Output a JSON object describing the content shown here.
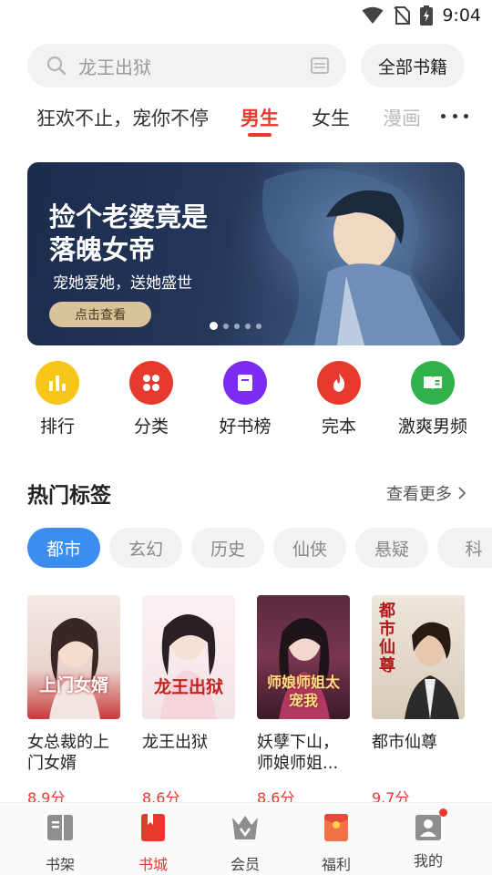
{
  "status_bar": {
    "time": "9:04"
  },
  "search": {
    "placeholder": "龙王出狱",
    "all_books_label": "全部书籍"
  },
  "tabs": [
    {
      "label": "狂欢不止，宠你不停"
    },
    {
      "label": "男生",
      "active": true
    },
    {
      "label": "女生"
    },
    {
      "label": "漫画"
    }
  ],
  "banner": {
    "title": "捡个老婆竟是\n落魄女帝",
    "subtitle": "宠她爱她，送她盛世",
    "button_label": "点击查看",
    "page_count": 5,
    "active_page": 0
  },
  "quick_entries": [
    {
      "label": "排行",
      "color": "#f5c518",
      "icon": "bar-chart-icon"
    },
    {
      "label": "分类",
      "color": "#e8392f",
      "icon": "grid-icon"
    },
    {
      "label": "好书榜",
      "color": "#7b2cf0",
      "icon": "booklist-icon"
    },
    {
      "label": "完本",
      "color": "#e8392f",
      "icon": "flame-icon"
    },
    {
      "label": "激爽男频",
      "color": "#2fb24a",
      "icon": "open-book-icon"
    }
  ],
  "hot_tags": {
    "title": "热门标签",
    "see_more": "查看更多",
    "items": [
      "都市",
      "玄幻",
      "历史",
      "仙侠",
      "悬疑",
      "科"
    ]
  },
  "books": [
    {
      "name": "女总裁的上门女婿",
      "score": "8.9分",
      "cover_text": "上门女婿"
    },
    {
      "name": "龙王出狱",
      "score": "8.6分",
      "cover_text": "龙王出狱"
    },
    {
      "name": "妖孽下山，师娘师姐...",
      "score": "8.6分",
      "cover_text": "师娘师姐太宠我"
    },
    {
      "name": "都市仙尊",
      "score": "9.7分",
      "cover_text": "都市仙尊"
    }
  ],
  "bottom_nav": [
    {
      "label": "书架"
    },
    {
      "label": "书城",
      "active": true
    },
    {
      "label": "会员"
    },
    {
      "label": "福利"
    },
    {
      "label": "我的",
      "badge": true
    }
  ],
  "colors": {
    "accent": "#e8392f",
    "tag_active": "#3b8ef0"
  }
}
